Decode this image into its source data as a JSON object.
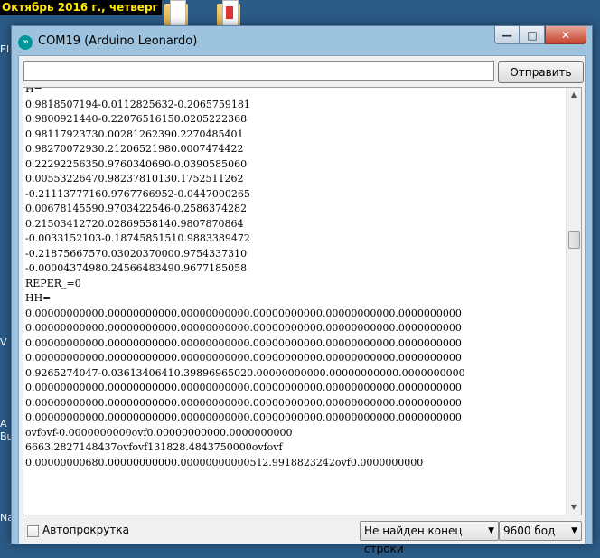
{
  "desktop": {
    "date_text": "Октябрь 2016 г., четверг",
    "side_fragments": [
      "El",
      "V",
      "A",
      "Bu",
      "Na"
    ]
  },
  "window": {
    "title": "COM19 (Arduino Leonardo)",
    "app_icon_text": "∞",
    "buttons": {
      "minimize": "—",
      "maximize": "□",
      "close": "✕"
    }
  },
  "send": {
    "input_value": "",
    "button_label": "Отправить"
  },
  "console": {
    "lines": [
      "Н=",
      "0.9818507194-0.0112825632-0.2065759181",
      "0.9800921440-0.22076516150.0205222368",
      "0.98117923730.00281262390.2270485401",
      "0.98270072930.21206521980.0007474422",
      "0.22292256350.9760340690-0.0390585060",
      "0.00553226470.98237810130.1752511262",
      "-0.21113777160.9767766952-0.0447000265",
      "0.00678145590.9703422546-0.2586374282",
      "0.21503412720.02869558140.9807870864",
      "-0.0033152103-0.18745851510.9883389472",
      "-0.21875667570.03020370000.9754337310",
      "-0.00004374980.24566483490.9677185058",
      "REPER_=0",
      "НН=",
      "0.00000000000.00000000000.00000000000.00000000000.00000000000.0000000000",
      "0.00000000000.00000000000.00000000000.00000000000.00000000000.0000000000",
      "0.00000000000.00000000000.00000000000.00000000000.00000000000.0000000000",
      "0.00000000000.00000000000.00000000000.00000000000.00000000000.0000000000",
      "0.9265274047-0.03613406410.39896965020.00000000000.00000000000.0000000000",
      "0.00000000000.00000000000.00000000000.00000000000.00000000000.0000000000",
      "0.00000000000.00000000000.00000000000.00000000000.00000000000.0000000000",
      "0.00000000000.00000000000.00000000000.00000000000.00000000000.0000000000",
      "ovfovf-0.0000000000ovf0.00000000000.0000000000",
      "6663.2827148437ovfovf131828.4843750000ovfovf",
      "0.00000000680.00000000000.00000000000512.9918823242ovf0.0000000000"
    ]
  },
  "footer": {
    "autoscroll_label": "Автопрокрутка",
    "autoscroll_checked": false,
    "line_ending": "Не найден конец строки",
    "baud_rate": "9600 бод"
  }
}
